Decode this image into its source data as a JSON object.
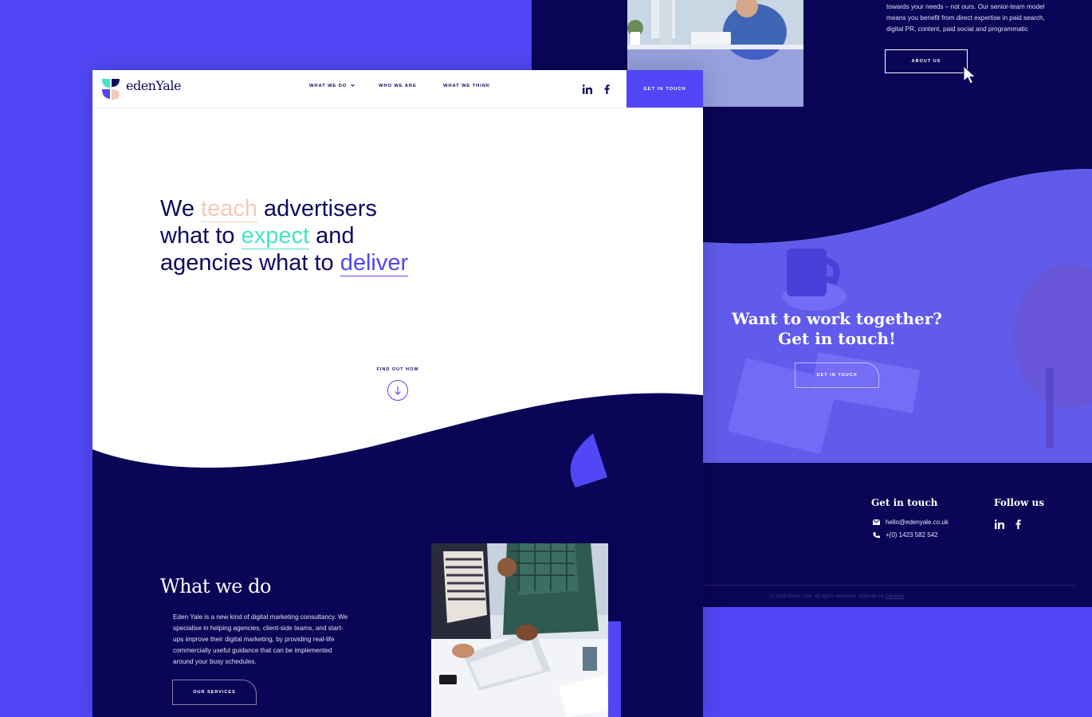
{
  "back": {
    "about_lines": [
      "towards your needs – not ours. Our senior-team model",
      "means you benefit from direct expertise in paid search,",
      "digital PR, content, paid social and programmatic"
    ],
    "about_button": "ABOUT US",
    "cta_title_line1": "Want to work together?",
    "cta_title_line2": "Get in touch!",
    "cta_button": "GET IN TOUCH",
    "footer": {
      "contact_heading": "Get in touch",
      "email": "hello@edenyale.co.uk",
      "phone": "+(0) 1423 582 542",
      "follow_heading": "Follow us",
      "copyright_text": "© 2018 Eden Yale. All rights reserved. Website by ",
      "credit_link": "Parallax"
    }
  },
  "front": {
    "logo_text": "edenYale",
    "nav": {
      "what_we_do": "WHAT WE DO",
      "who_we_are": "WHO WE ARE",
      "what_we_think": "WHAT WE THINK",
      "cta": "GET IN TOUCH"
    },
    "hero": {
      "l1_a": "We ",
      "l1_hl": "teach",
      "l1_b": " advertisers",
      "l2_a": "what to ",
      "l2_hl": "expect",
      "l2_b": " and",
      "l3_a": "agencies what to ",
      "l3_hl": "deliver"
    },
    "find_out_how": "FIND OUT HOW",
    "what_we_do": {
      "title": "What we do",
      "body_lines": [
        "Eden Yale is a new kind of digital marketing consultancy. We",
        "specialise in helping agencies, client-side teams, and start-",
        "ups improve their digital marketing, by providing real-life",
        "commercially useful guidance that can be implemented",
        "around your busy schedules."
      ],
      "button": "OUR SERVICES"
    }
  },
  "colors": {
    "background": "#5147f6",
    "navy": "#0a0556",
    "accent": "#5147f6",
    "peach": "#f3c9b5",
    "mint": "#44e3c6"
  },
  "icons": [
    "linkedin-icon",
    "facebook-icon",
    "chevron-down-icon",
    "arrow-down-icon",
    "mail-icon",
    "phone-icon",
    "mouse-cursor-icon"
  ]
}
